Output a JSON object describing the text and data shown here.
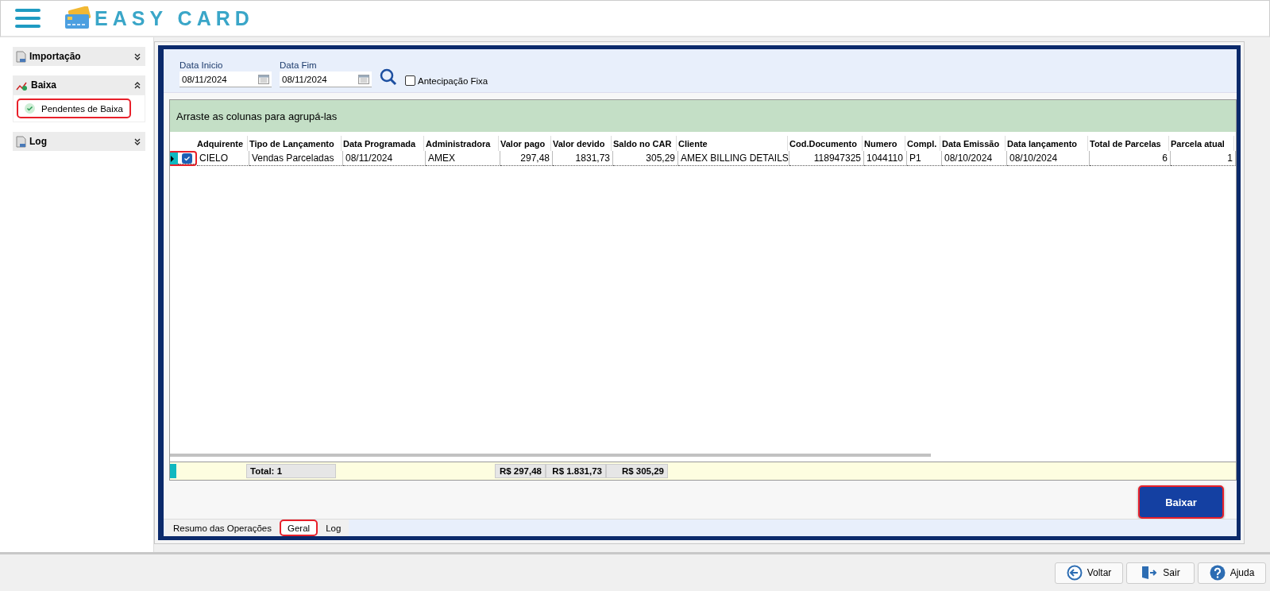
{
  "app": {
    "title": "EASY CARD"
  },
  "sidebar": {
    "groups": [
      {
        "label": "Importação",
        "expanded": false
      },
      {
        "label": "Baixa",
        "expanded": true,
        "items": [
          {
            "label": "Pendentes de Baixa",
            "selected": true,
            "highlighted": true
          }
        ]
      },
      {
        "label": "Log",
        "expanded": false
      }
    ]
  },
  "filters": {
    "start": {
      "label": "Data Inicio",
      "value": "08/11/2024"
    },
    "end": {
      "label": "Data Fim",
      "value": "08/11/2024"
    },
    "fixed_advance": {
      "label": "Antecipação Fixa",
      "checked": false
    }
  },
  "grid": {
    "group_hint": "Arraste as colunas para agrupá-las",
    "columns": [
      "Adquirente",
      "Tipo de Lançamento",
      "Data Programada",
      "Administradora",
      "Valor pago",
      "Valor devido",
      "Saldo no CAR",
      "Cliente",
      "Cod.Documento",
      "Numero",
      "Compl.",
      "Data Emissão",
      "Data lançamento",
      "Total de Parcelas",
      "Parcela atual"
    ],
    "rows": [
      {
        "selected": true,
        "checked": true,
        "highlighted": true,
        "cells": [
          "CIELO",
          "Vendas Parceladas",
          "08/11/2024",
          "AMEX",
          "297,48",
          "1831,73",
          "305,29",
          "AMEX BILLING DETAILS",
          "118947325",
          "1044110",
          "P1",
          "08/10/2024",
          "08/10/2024",
          "6",
          "1"
        ]
      }
    ],
    "summary": {
      "count": "Total: 1",
      "valor_pago": "R$ 297,48",
      "valor_devido": "R$ 1.831,73",
      "saldo": "R$ 305,29"
    }
  },
  "action_button": {
    "label": "Baixar",
    "highlighted": true
  },
  "tabs": [
    {
      "label": "Resumo das Operações",
      "selected": false,
      "highlighted": false
    },
    {
      "label": "Geral",
      "selected": true,
      "highlighted": true
    },
    {
      "label": "Log",
      "selected": false,
      "highlighted": false
    }
  ],
  "footer_buttons": [
    {
      "kind": "back",
      "label": "Voltar"
    },
    {
      "kind": "exit",
      "label": "Sair"
    },
    {
      "kind": "help",
      "label": "Ajuda"
    }
  ]
}
